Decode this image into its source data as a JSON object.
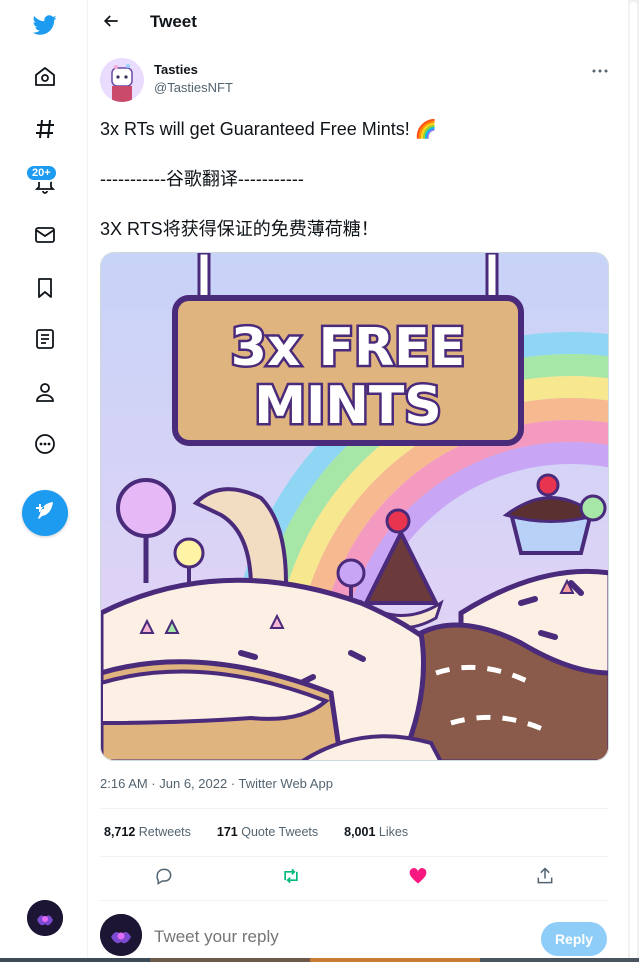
{
  "nav": {
    "badge": "20+",
    "icons": [
      "twitter-logo-icon",
      "home-icon",
      "explore-hashtag-icon",
      "notifications-bell-icon",
      "messages-mail-icon",
      "bookmarks-icon",
      "lists-icon",
      "profile-icon",
      "more-circle-icon"
    ],
    "compose_icon": "feather-icon",
    "brand_color": "#1d9bf0"
  },
  "header": {
    "title": "Tweet"
  },
  "tweet": {
    "author_name": "Tasties",
    "author_handle": "@TastiesNFT",
    "line1": "3x RTs will get Guaranteed Free Mints! 🌈",
    "line2": "-----------谷歌翻译-----------",
    "line3": "3X RTS将获得保证的免费薄荷糖！",
    "image": {
      "sign_line1": "3x FREE",
      "sign_line2": "MINTS"
    },
    "timestamp": "2:16 AM · Jun 6, 2022 · Twitter Web App"
  },
  "stats": {
    "retweets_count": "8,712",
    "retweets_label": "Retweets",
    "quotes_count": "171",
    "quotes_label": "Quote Tweets",
    "likes_count": "8,001",
    "likes_label": "Likes"
  },
  "actions": [
    "reply-icon",
    "retweet-icon",
    "like-heart-icon",
    "share-icon"
  ],
  "reply": {
    "placeholder": "Tweet your reply",
    "button_label": "Reply"
  },
  "colors": {
    "accent": "#1d9bf0",
    "retweet_green": "#00ba7c",
    "like_pink": "#f91880",
    "muted_text": "#536471"
  }
}
